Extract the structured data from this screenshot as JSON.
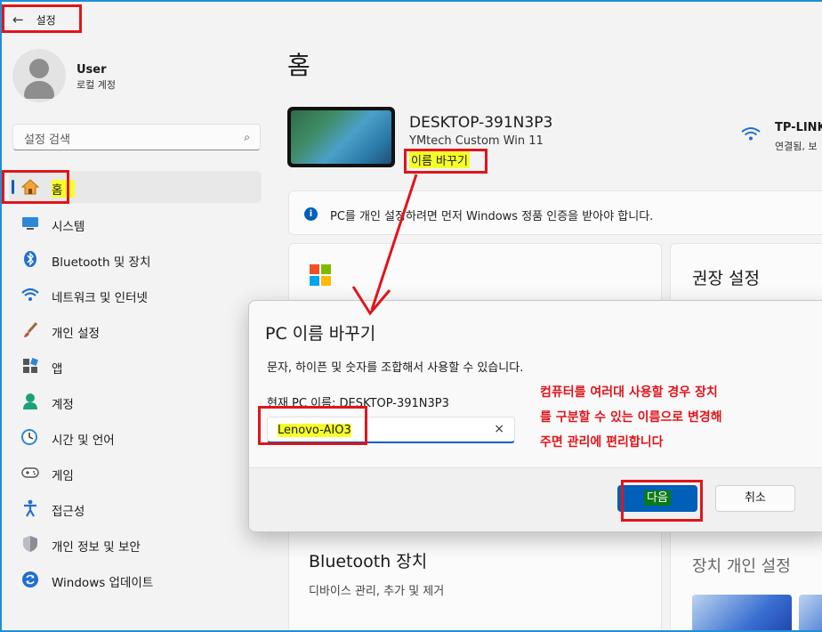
{
  "titlebar": {
    "back_icon": "←",
    "title": "설정"
  },
  "user": {
    "name": "User",
    "account_type": "로컬 계정"
  },
  "search": {
    "placeholder": "설정 검색",
    "icon": "search-icon"
  },
  "nav": [
    {
      "label": "홈",
      "icon": "home-icon",
      "selected": true
    },
    {
      "label": "시스템",
      "icon": "monitor-icon"
    },
    {
      "label": "Bluetooth 및 장치",
      "icon": "bluetooth-icon"
    },
    {
      "label": "네트워크 및 인터넷",
      "icon": "wifi-icon"
    },
    {
      "label": "개인 설정",
      "icon": "brush-icon"
    },
    {
      "label": "앱",
      "icon": "apps-icon"
    },
    {
      "label": "계정",
      "icon": "person-icon"
    },
    {
      "label": "시간 및 언어",
      "icon": "clock-globe-icon"
    },
    {
      "label": "게임",
      "icon": "gamepad-icon"
    },
    {
      "label": "접근성",
      "icon": "accessibility-icon"
    },
    {
      "label": "개인 정보 및 보안",
      "icon": "shield-icon"
    },
    {
      "label": "Windows 업데이트",
      "icon": "update-icon"
    }
  ],
  "main": {
    "page_title": "홈",
    "device": {
      "name": "DESKTOP-391N3P3",
      "model": "YMtech Custom Win 11",
      "rename_link": "이름 바꾸기"
    },
    "network": {
      "name": "TP-LINK",
      "status": "연결됨, 보"
    },
    "activation_notice": "PC를 개인 설정하려면 먼저 Windows 정품 인증을 받아야 합니다.",
    "recommended_title": "권장 설정",
    "bluetooth_card": {
      "title": "Bluetooth 장치",
      "subtitle": "디바이스 관리, 추가 및 제거"
    },
    "personalize_title": "장치 개인 설정"
  },
  "dialog": {
    "title": "PC 이름 바꾸기",
    "description": "문자, 하이픈 및 숫자를 조합해서 사용할 수 있습니다.",
    "current_label": "현재 PC 이름: DESKTOP-391N3P3",
    "input_value": "Lenovo-AIO3",
    "clear_icon": "×",
    "next_label": "다음",
    "cancel_label": "취소"
  },
  "annotation": {
    "line1": "컴퓨터를 여러대 사용할 경우 장치",
    "line2": "를 구분할 수 있는 이름으로 변경해",
    "line3": "주면 관리에 편리합니다"
  },
  "colors": {
    "accent": "#005fb8",
    "annotation_red": "#e0151b",
    "highlight_yellow": "#f6ff29"
  }
}
